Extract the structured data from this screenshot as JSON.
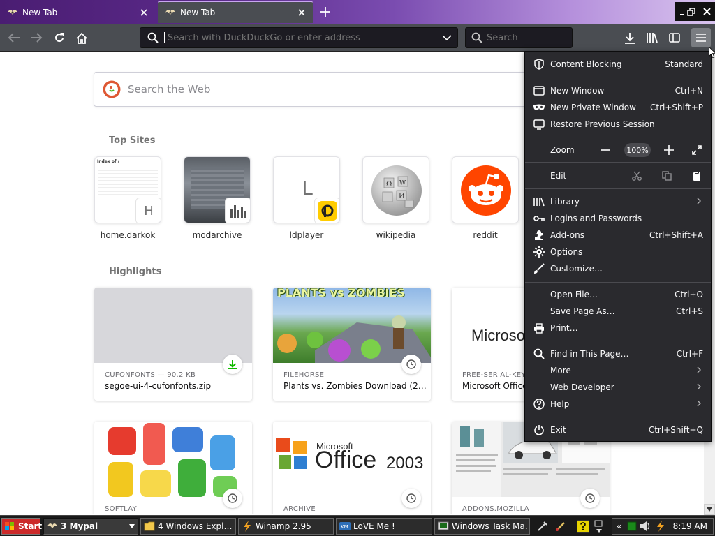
{
  "browser": {
    "tabs": [
      {
        "title": "New Tab",
        "active": false
      },
      {
        "title": "New Tab",
        "active": true
      }
    ],
    "url_placeholder": "Search with DuckDuckGo or enter address",
    "search_placeholder": "Search"
  },
  "newtab": {
    "web_search_placeholder": "Search the Web",
    "top_sites_title": "Top Sites",
    "highlights_title": "Highlights",
    "top_sites": [
      {
        "label": "home.darkok",
        "badge": "H"
      },
      {
        "label": "modarchive"
      },
      {
        "label": "ldplayer",
        "letter": "L"
      },
      {
        "label": "wikipedia"
      },
      {
        "label": "reddit"
      }
    ],
    "highlights": [
      {
        "source": "CUFONFONTS — 90.2 KB",
        "title": "segoe-ui-4-cufonfonts.zip",
        "badge": "download-icon"
      },
      {
        "source": "FILEHORSE",
        "title": "Plants vs. Zombies Download (2…",
        "image_text": "PLANTS vs ZOMBIES",
        "badge": "clock-icon"
      },
      {
        "source": "FREE-SERIAL-KEY…",
        "title": "Microsoft Office…",
        "image_text": "Microsof Offi",
        "badge": "clock-icon"
      }
    ],
    "highlights_row2": [
      {
        "source": "SOFTLAY"
      },
      {
        "source": "ARCHIVE",
        "image_text_brand": "Microsoft",
        "image_text_product": "Office",
        "image_text_year": "2003"
      },
      {
        "source": "ADDONS.MOZILLA"
      }
    ]
  },
  "app_menu": {
    "content_blocking": {
      "label": "Content Blocking",
      "value": "Standard"
    },
    "new_window": {
      "label": "New Window",
      "shortcut": "Ctrl+N"
    },
    "new_private_window": {
      "label": "New Private Window",
      "shortcut": "Ctrl+Shift+P"
    },
    "restore_session": {
      "label": "Restore Previous Session"
    },
    "zoom": {
      "label": "Zoom",
      "value": "100%"
    },
    "edit": {
      "label": "Edit"
    },
    "library": {
      "label": "Library"
    },
    "logins": {
      "label": "Logins and Passwords"
    },
    "addons": {
      "label": "Add-ons",
      "shortcut": "Ctrl+Shift+A"
    },
    "options": {
      "label": "Options"
    },
    "customize": {
      "label": "Customize…"
    },
    "open_file": {
      "label": "Open File…",
      "shortcut": "Ctrl+O"
    },
    "save_page": {
      "label": "Save Page As…",
      "shortcut": "Ctrl+S"
    },
    "print": {
      "label": "Print…"
    },
    "find": {
      "label": "Find in This Page…",
      "shortcut": "Ctrl+F"
    },
    "more": {
      "label": "More"
    },
    "web_developer": {
      "label": "Web Developer"
    },
    "help": {
      "label": "Help"
    },
    "exit": {
      "label": "Exit",
      "shortcut": "Ctrl+Shift+Q"
    }
  },
  "taskbar": {
    "start": "Start",
    "buttons": [
      {
        "label": "3 Mypal"
      },
      {
        "label": "4 Windows Expl…"
      },
      {
        "label": "Winamp 2.95"
      },
      {
        "label": "LoVE Me !"
      },
      {
        "label": "Windows Task Ma…"
      }
    ],
    "clock": "8:19 AM"
  },
  "colors": {
    "titlebar_gradient_start": "#4a1d72",
    "toolbar": "#4a4d52",
    "menu_bg": "#2a2a2e",
    "accent_green": "#12bc00",
    "reddit_orange": "#ff4500"
  }
}
